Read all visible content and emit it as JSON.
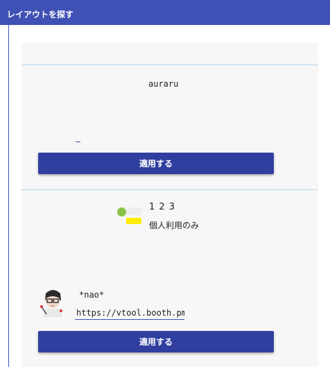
{
  "header": {
    "title": "レイアウトを探す"
  },
  "cards": [
    {
      "name": "auraru",
      "apply_label": "適用する"
    },
    {
      "name": "1 2 3",
      "license": "個人利用のみ",
      "author": "*nao*",
      "author_url": "https://vtool.booth.pm/",
      "apply_label": "適用する"
    }
  ],
  "colors": {
    "header": "#3f51b5",
    "button": "#303f9f",
    "divider": "#b9d4ea",
    "dot_green": "#8bc34a",
    "chip_yellow": "#ffee00"
  },
  "icons": {
    "avatar": "author-avatar-image"
  }
}
